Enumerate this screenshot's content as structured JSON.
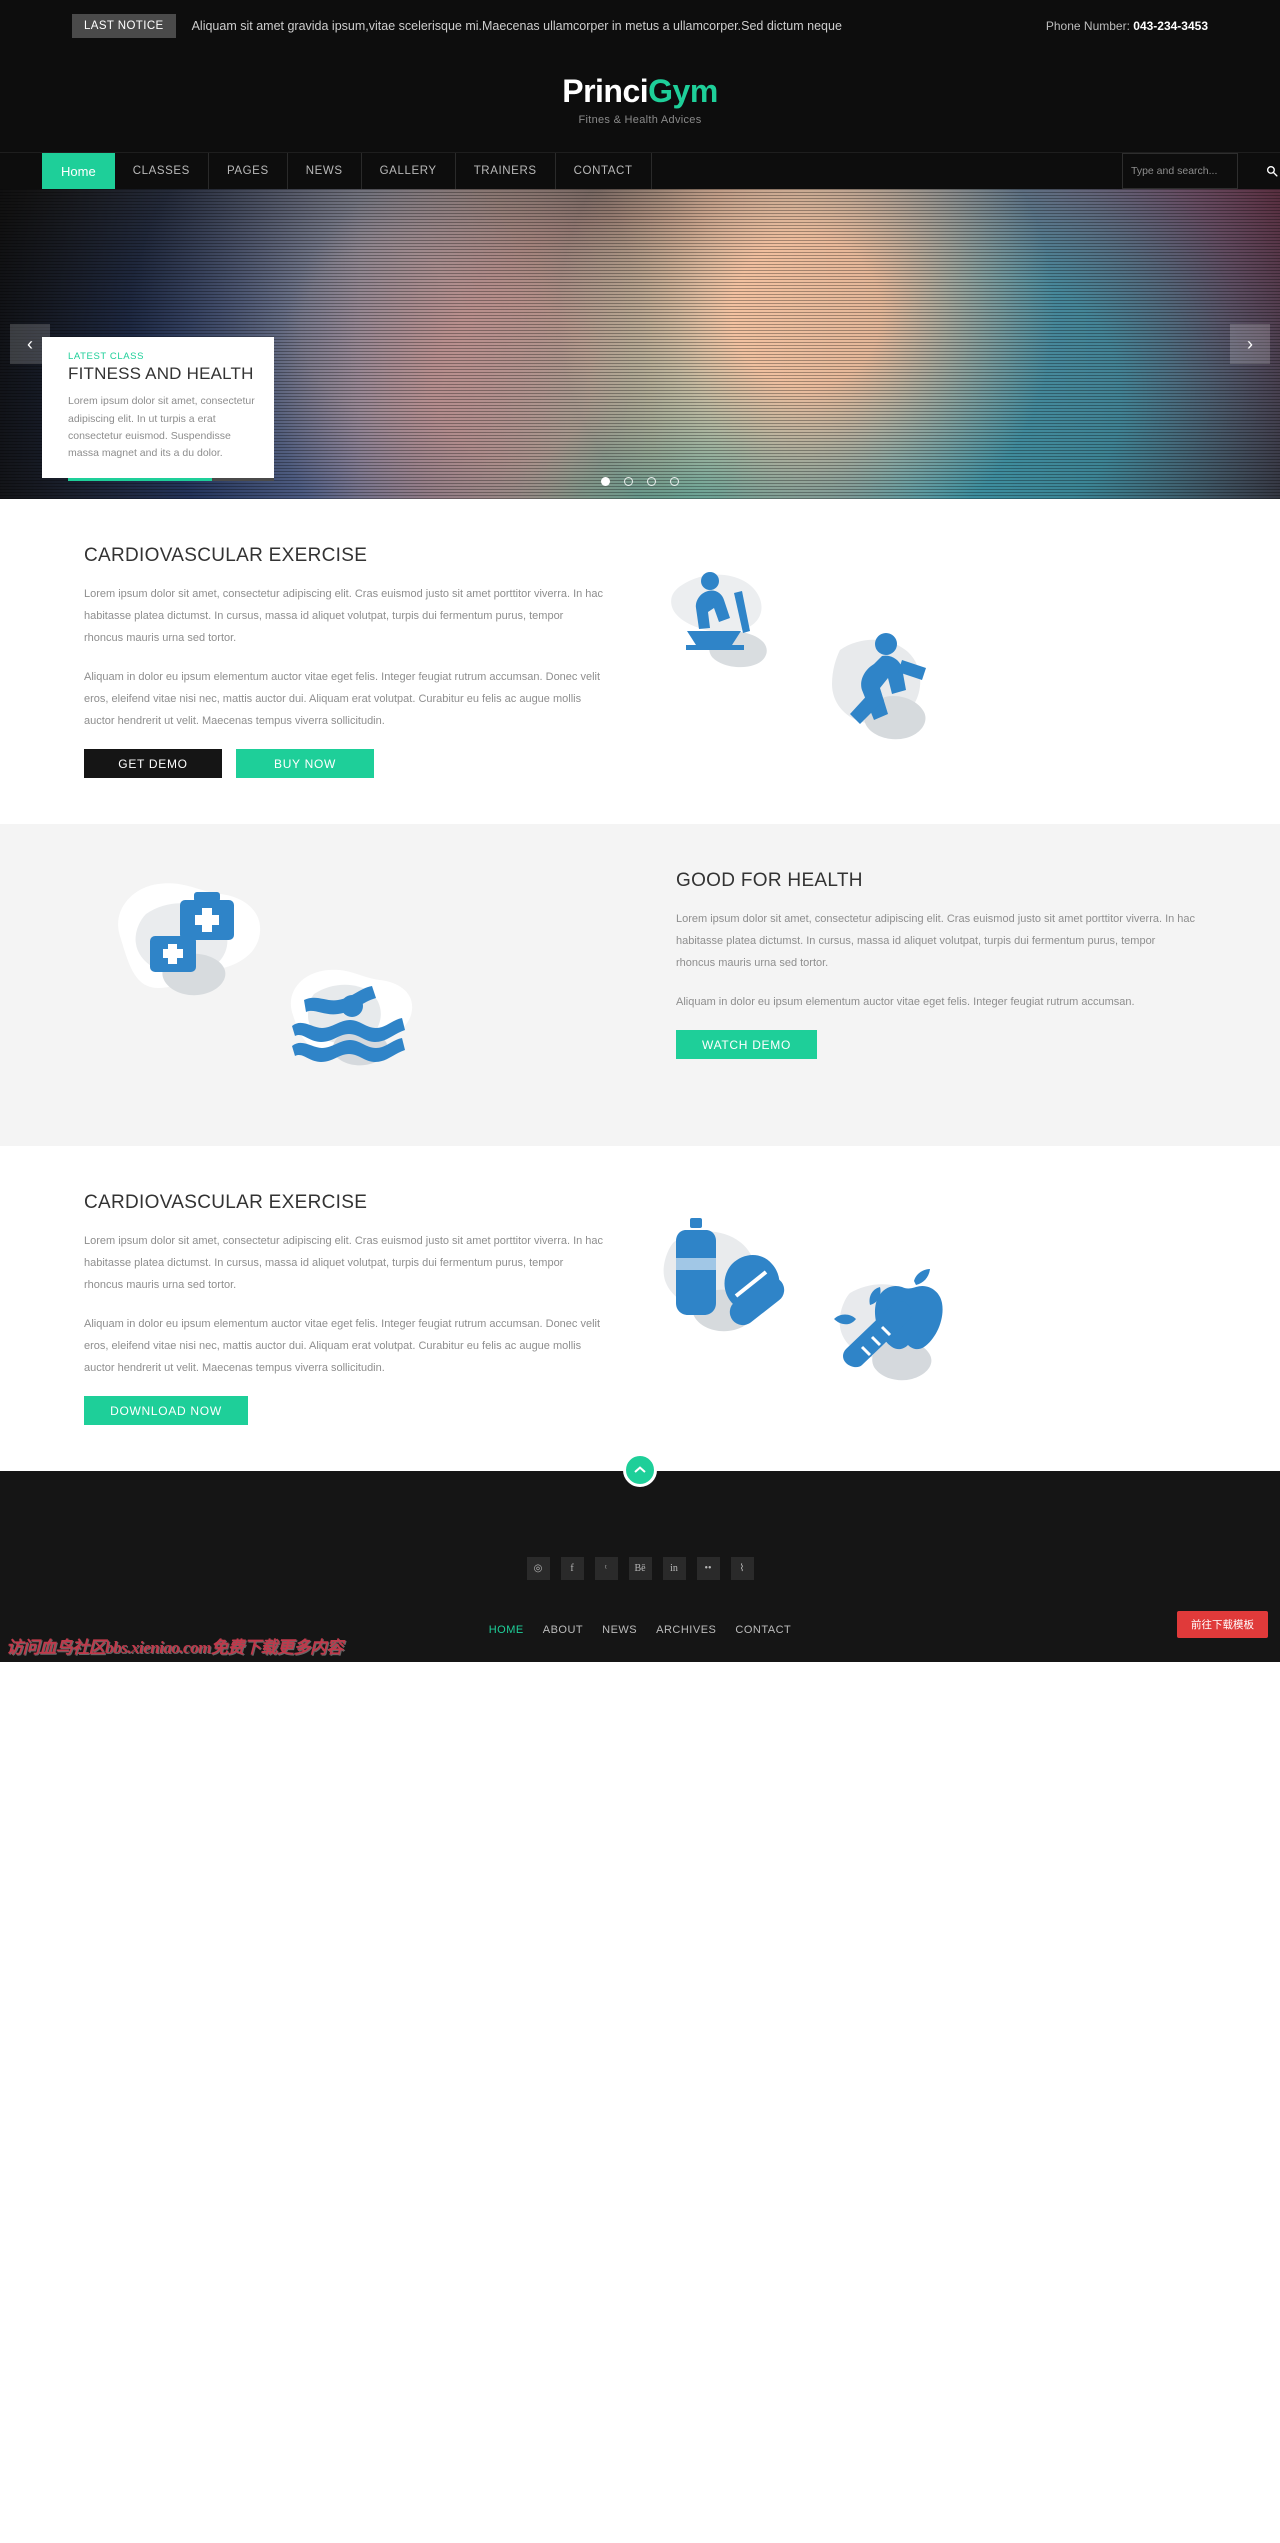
{
  "topbar": {
    "badge": "LAST NOTICE",
    "notice": "Aliquam sit amet gravida ipsum,vitae scelerisque mi.Maecenas ullamcorper in metus a ullamcorper.Sed dictum neque",
    "phone_label": "Phone Number:",
    "phone_number": "043-234-3453"
  },
  "brand": {
    "name_first": "Princi",
    "name_second": "Gym",
    "tagline": "Fitnes & Health Advices",
    "accent_color": "#1ecf99"
  },
  "nav": {
    "items": [
      {
        "label": "Home",
        "active": true
      },
      {
        "label": "CLASSES",
        "active": false
      },
      {
        "label": "PAGES",
        "active": false
      },
      {
        "label": "NEWS",
        "active": false
      },
      {
        "label": "GALLERY",
        "active": false
      },
      {
        "label": "TRAINERS",
        "active": false
      },
      {
        "label": "CONTACT",
        "active": false
      }
    ],
    "search_placeholder": "Type and search...",
    "search_value": ""
  },
  "hero": {
    "prev_label": "‹",
    "next_label": "›",
    "caption": {
      "kicker": "LATEST CLASS",
      "title": "FITNESS AND HEALTH",
      "body": "Lorem ipsum dolor sit amet, consectetur adipiscing elit. In ut turpis a erat consectetur euismod. Suspendisse massa magnet and its a du dolor."
    },
    "dots_total": 4,
    "dot_active_index": 0
  },
  "section_one": {
    "title": "CARDIOVASCULAR EXERCISE",
    "paragraph_1": "Lorem ipsum dolor sit amet, consectetur adipiscing elit. Cras euismod justo sit amet porttitor viverra. In hac habitasse platea dictumst. In cursus, massa id aliquet volutpat, turpis dui fermentum purus, tempor rhoncus mauris urna sed tortor.",
    "paragraph_2": "Aliquam in dolor eu ipsum elementum auctor vitae eget felis. Integer feugiat rutrum accumsan. Donec velit eros, eleifend vitae nisi nec, mattis auctor dui. Aliquam erat volutpat. Curabitur eu felis ac augue mollis auctor hendrerit ut velit. Maecenas tempus viverra sollicitudin.",
    "button_primary": "GET DEMO",
    "button_secondary": "BUY NOW",
    "art_icons": [
      "treadmill-runner-icon",
      "climbing-person-icon"
    ]
  },
  "section_two": {
    "title": "GOOD FOR HEALTH",
    "paragraph_1": "Lorem ipsum dolor sit amet, consectetur adipiscing elit. Cras euismod justo sit amet porttitor viverra. In hac habitasse platea dictumst. In cursus, massa id aliquet volutpat, turpis dui fermentum purus, tempor rhoncus mauris urna sed tortor.",
    "paragraph_2": "Aliquam in dolor eu ipsum elementum auctor vitae eget felis. Integer feugiat rutrum accumsan.",
    "button_primary": "WATCH DEMO",
    "art_icons": [
      "first-aid-kit-icon",
      "swimmer-icon"
    ]
  },
  "section_three": {
    "title": "CARDIOVASCULAR EXERCISE",
    "paragraph_1": "Lorem ipsum dolor sit amet, consectetur adipiscing elit. Cras euismod justo sit amet porttitor viverra. In hac habitasse platea dictumst. In cursus, massa id aliquet volutpat, turpis dui fermentum purus, tempor rhoncus mauris urna sed tortor.",
    "paragraph_2": "Aliquam in dolor eu ipsum elementum auctor vitae eget felis. Integer feugiat rutrum accumsan. Donec velit eros, eleifend vitae nisi nec, mattis auctor dui. Aliquam erat volutpat. Curabitur eu felis ac augue mollis auctor hendrerit ut velit. Maecenas tempus viverra sollicitudin.",
    "button_primary": "DOWNLOAD NOW",
    "art_icons": [
      "water-bottle-pills-icon",
      "apple-carrot-icon"
    ]
  },
  "scroll_top": {
    "icon": "chevron-up-icon"
  },
  "footer": {
    "social": [
      {
        "name": "dribbble-icon",
        "glyph": "◎"
      },
      {
        "name": "facebook-icon",
        "glyph": "f"
      },
      {
        "name": "twitter-icon",
        "glyph": "ᵗ"
      },
      {
        "name": "behance-icon",
        "glyph": "Bē"
      },
      {
        "name": "linkedin-icon",
        "glyph": "in"
      },
      {
        "name": "flickr-icon",
        "glyph": "••"
      },
      {
        "name": "rss-icon",
        "glyph": "⌇"
      }
    ],
    "links": [
      {
        "label": "HOME",
        "active": true
      },
      {
        "label": "ABOUT",
        "active": false
      },
      {
        "label": "NEWS",
        "active": false
      },
      {
        "label": "ARCHIVES",
        "active": false
      },
      {
        "label": "CONTACT",
        "active": false
      }
    ],
    "watermark": "访问血鸟社区bbs.xieniao.com免费下载更多内容",
    "download_chip": "前往下载模板"
  }
}
